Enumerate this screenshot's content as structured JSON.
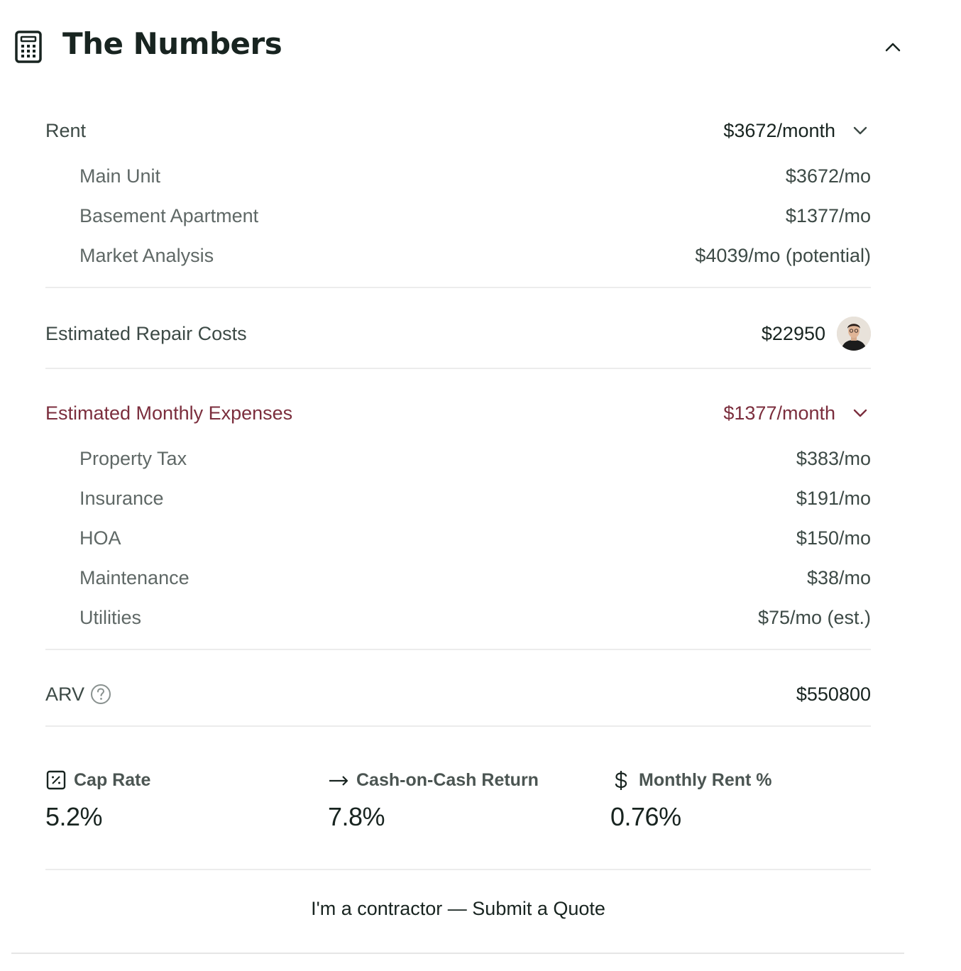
{
  "header": {
    "title": "The Numbers",
    "icon": "calculator-icon",
    "collapse_icon": "chevron-up-icon"
  },
  "rent": {
    "label": "Rent",
    "total": "$3672/month",
    "items": [
      {
        "label": "Main Unit",
        "value": "$3672/mo"
      },
      {
        "label": "Basement Apartment",
        "value": "$1377/mo"
      },
      {
        "label": "Market Analysis",
        "value": "$4039/mo (potential)"
      }
    ]
  },
  "repair": {
    "label": "Estimated Repair Costs",
    "value": "$22950"
  },
  "expenses": {
    "label": "Estimated Monthly Expenses",
    "total": "$1377/month",
    "accent": "#7b2e3d",
    "items": [
      {
        "label": "Property Tax",
        "value": "$383/mo"
      },
      {
        "label": "Insurance",
        "value": "$191/mo"
      },
      {
        "label": "HOA",
        "value": "$150/mo"
      },
      {
        "label": "Maintenance",
        "value": "$38/mo"
      },
      {
        "label": "Utilities",
        "value": "$75/mo (est.)"
      }
    ]
  },
  "arv": {
    "label": "ARV",
    "value": "$550800"
  },
  "metrics": {
    "cap_rate": {
      "label": "Cap Rate",
      "value": "5.2%",
      "icon": "percent-box-icon"
    },
    "coc": {
      "label": "Cash-on-Cash Return",
      "value": "7.8%",
      "icon": "arrow-right-icon"
    },
    "rent_pct": {
      "label": "Monthly Rent %",
      "value": "0.76%",
      "icon": "dollar-icon"
    }
  },
  "cta": {
    "label": "I'm a contractor — Submit a Quote"
  }
}
